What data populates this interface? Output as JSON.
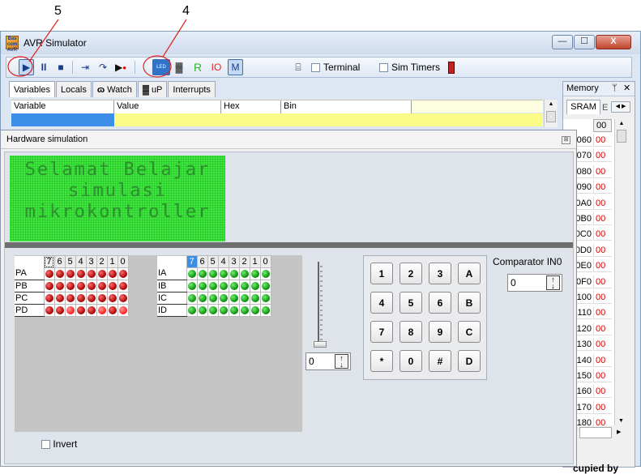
{
  "callouts": {
    "left": "5",
    "right": "4"
  },
  "window": {
    "title": "AVR Simulator",
    "icon_text": "Bas com AVR",
    "buttons": {
      "minimize": "—",
      "maximize": "☐",
      "close": "X"
    }
  },
  "toolbar": {
    "run": "▶",
    "pause": "II",
    "stop": "■",
    "step_into": "⇥",
    "step_over": "↷",
    "run_to": "▶",
    "hardware": "LED",
    "chip": "▓",
    "reg_r": "R",
    "reg_io": "IO",
    "reg_m": "M",
    "terminal_label": "Terminal",
    "sim_timers_label": "Sim Timers"
  },
  "tabs": [
    {
      "label": "Variables"
    },
    {
      "label": "Locals"
    },
    {
      "label": "Watch"
    },
    {
      "label": "uP"
    },
    {
      "label": "Interrupts"
    }
  ],
  "variables_grid": {
    "columns": [
      "Variable",
      "Value",
      "Hex",
      "Bin"
    ]
  },
  "memory": {
    "title": "Memory",
    "pin": "ᛘ",
    "close": "✕",
    "tab": "SRAM",
    "tab_next": "E",
    "col_header": "00",
    "rows": [
      {
        "addr": "060",
        "val": "00"
      },
      {
        "addr": "070",
        "val": "00"
      },
      {
        "addr": "080",
        "val": "00"
      },
      {
        "addr": "090",
        "val": "00"
      },
      {
        "addr": "0A0",
        "val": "00"
      },
      {
        "addr": "0B0",
        "val": "00"
      },
      {
        "addr": "0C0",
        "val": "00"
      },
      {
        "addr": "0D0",
        "val": "00"
      },
      {
        "addr": "0E0",
        "val": "00"
      },
      {
        "addr": "0F0",
        "val": "00"
      },
      {
        "addr": "100",
        "val": "00"
      },
      {
        "addr": "110",
        "val": "00"
      },
      {
        "addr": "120",
        "val": "00"
      },
      {
        "addr": "130",
        "val": "00"
      },
      {
        "addr": "140",
        "val": "00"
      },
      {
        "addr": "150",
        "val": "00"
      },
      {
        "addr": "160",
        "val": "00"
      },
      {
        "addr": "170",
        "val": "00"
      },
      {
        "addr": "180",
        "val": "00"
      }
    ],
    "footer": "cupied by"
  },
  "hardware": {
    "title": "Hardware simulation",
    "lcd_lines": [
      "Selamat Belajar",
      "simulasi",
      "mikrokontroller"
    ],
    "bit_headers": [
      "7",
      "6",
      "5",
      "4",
      "3",
      "2",
      "1",
      "0"
    ],
    "output_ports": [
      "PA",
      "PB",
      "PC",
      "PD"
    ],
    "input_ports": [
      "IA",
      "IB",
      "IC",
      "ID"
    ],
    "slider_value": "0",
    "keypad": [
      "1",
      "2",
      "3",
      "A",
      "4",
      "5",
      "6",
      "B",
      "7",
      "8",
      "9",
      "C",
      "*",
      "0",
      "#",
      "D"
    ],
    "comparator_label": "Comparator IN0",
    "comparator_value": "0",
    "invert_label": "Invert"
  }
}
